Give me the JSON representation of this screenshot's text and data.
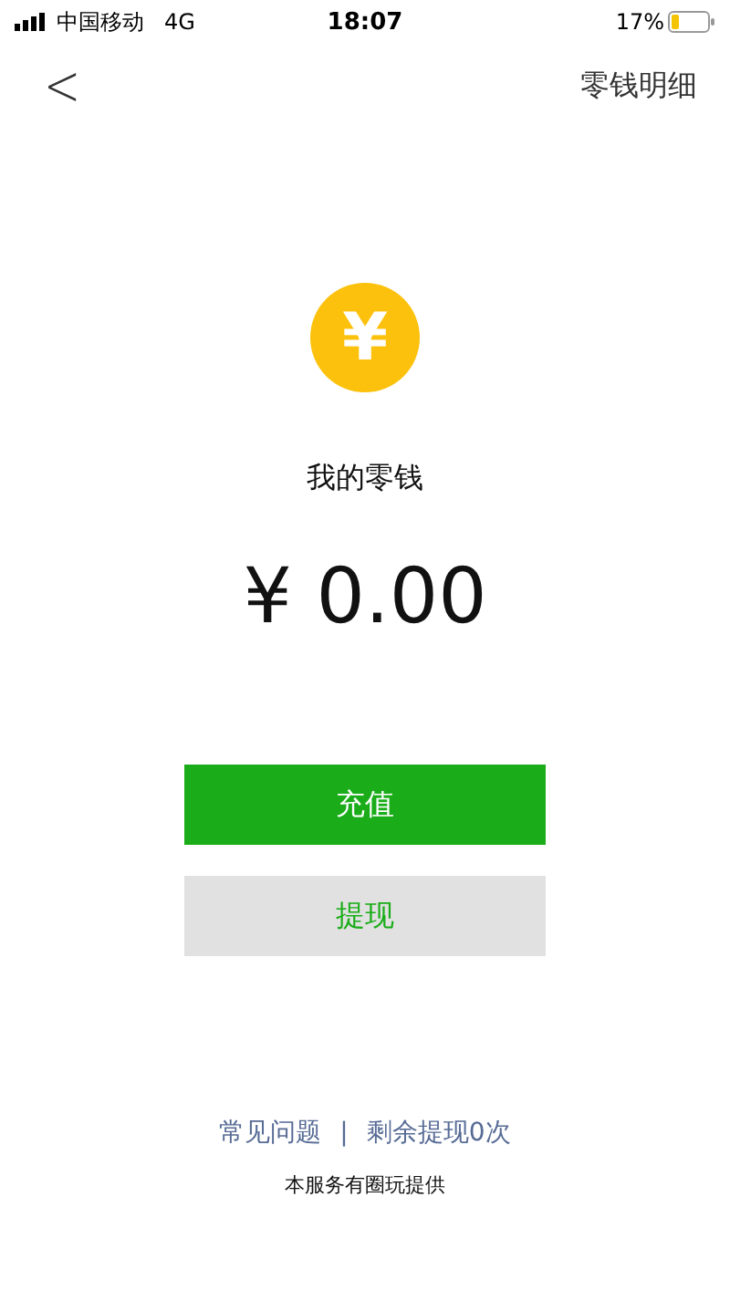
{
  "status_bar": {
    "carrier": "中国移动",
    "network": "4G",
    "time": "18:07",
    "battery": "17%"
  },
  "nav_bar": {
    "back": "<",
    "action": "零钱明细"
  },
  "balance": {
    "coin_symbol": "¥",
    "label": "我的零钱",
    "amount": "¥ 0.00"
  },
  "buttons": [
    {
      "label": "充值",
      "kind": "primary"
    },
    {
      "label": "提现",
      "kind": "secondary"
    }
  ],
  "links": [
    {
      "label": "常见问题"
    },
    {
      "label": "剩余提现0次"
    }
  ],
  "separator": "|",
  "footer": "本服务有圈玩提供"
}
